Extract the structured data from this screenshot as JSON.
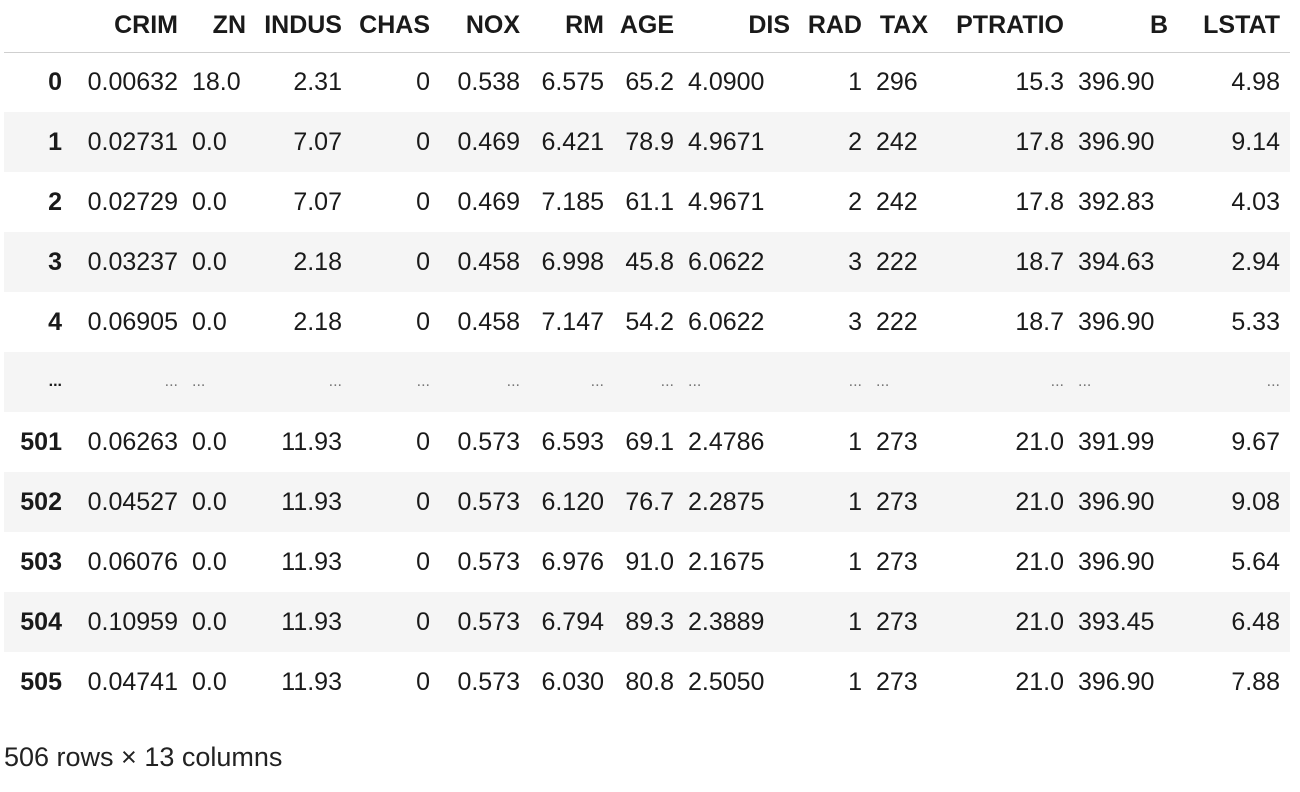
{
  "columns": [
    "",
    "CRIM",
    "ZN",
    "INDUS",
    "CHAS",
    "NOX",
    "RM",
    "AGE",
    "DIS",
    "RAD",
    "TAX",
    "PTRATIO",
    "B",
    "LSTAT"
  ],
  "rows": [
    [
      "0",
      "0.00632",
      "18.0",
      "2.31",
      "0",
      "0.538",
      "6.575",
      "65.2",
      "4.0900",
      "1",
      "296",
      "15.3",
      "396.90",
      "4.98"
    ],
    [
      "1",
      "0.02731",
      "0.0",
      "7.07",
      "0",
      "0.469",
      "6.421",
      "78.9",
      "4.9671",
      "2",
      "242",
      "17.8",
      "396.90",
      "9.14"
    ],
    [
      "2",
      "0.02729",
      "0.0",
      "7.07",
      "0",
      "0.469",
      "7.185",
      "61.1",
      "4.9671",
      "2",
      "242",
      "17.8",
      "392.83",
      "4.03"
    ],
    [
      "3",
      "0.03237",
      "0.0",
      "2.18",
      "0",
      "0.458",
      "6.998",
      "45.8",
      "6.0622",
      "3",
      "222",
      "18.7",
      "394.63",
      "2.94"
    ],
    [
      "4",
      "0.06905",
      "0.0",
      "2.18",
      "0",
      "0.458",
      "7.147",
      "54.2",
      "6.0622",
      "3",
      "222",
      "18.7",
      "396.90",
      "5.33"
    ],
    [
      "...",
      "...",
      "...",
      "...",
      "...",
      "...",
      "...",
      "...",
      "...",
      "...",
      "...",
      "...",
      "...",
      "..."
    ],
    [
      "501",
      "0.06263",
      "0.0",
      "11.93",
      "0",
      "0.573",
      "6.593",
      "69.1",
      "2.4786",
      "1",
      "273",
      "21.0",
      "391.99",
      "9.67"
    ],
    [
      "502",
      "0.04527",
      "0.0",
      "11.93",
      "0",
      "0.573",
      "6.120",
      "76.7",
      "2.2875",
      "1",
      "273",
      "21.0",
      "396.90",
      "9.08"
    ],
    [
      "503",
      "0.06076",
      "0.0",
      "11.93",
      "0",
      "0.573",
      "6.976",
      "91.0",
      "2.1675",
      "1",
      "273",
      "21.0",
      "396.90",
      "5.64"
    ],
    [
      "504",
      "0.10959",
      "0.0",
      "11.93",
      "0",
      "0.573",
      "6.794",
      "89.3",
      "2.3889",
      "1",
      "273",
      "21.0",
      "393.45",
      "6.48"
    ],
    [
      "505",
      "0.04741",
      "0.0",
      "11.93",
      "0",
      "0.573",
      "6.030",
      "80.8",
      "2.5050",
      "1",
      "273",
      "21.0",
      "396.90",
      "7.88"
    ]
  ],
  "summary": "506 rows × 13 columns"
}
